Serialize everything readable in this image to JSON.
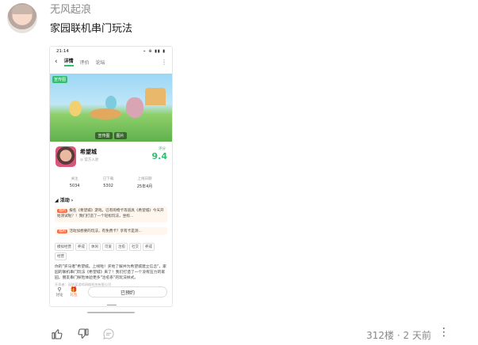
{
  "post": {
    "username": "无风起浪",
    "text": "家园联机串门玩法"
  },
  "screenshot": {
    "status_time": "21:14",
    "status_icons": "⌁ ⊕ ▮▮ ▮",
    "nav_tabs": [
      "详情",
      "评价",
      "论坛"
    ],
    "banner_tag": "宣传图",
    "banner_pills": [
      "宣传图",
      "图片"
    ],
    "app_name": "希望城",
    "app_sub": "◎ 官方入驻",
    "score_label": "评分",
    "score": "9.4",
    "stats": [
      {
        "k": "关注",
        "v": "5034"
      },
      {
        "k": "已下载",
        "v": "5302"
      },
      {
        "k": "上线日期",
        "v": "25年4月"
      }
    ],
    "section_title": "◢ 活动 ›",
    "event1_badge": "福利",
    "event1_text": "报名《希望城》游戏，已有购物卡等道具《希望城》今天开始测试啦？！我们打造了一个轻松玩法，坐标...",
    "event2_badge": "福利",
    "event2_text": "活动加想要的玩法，有免费卡？享有卡是测...",
    "chips": [
      "模拟经营",
      "养成",
      "休闲",
      "可爱",
      "治愈",
      "社交",
      "养成",
      "经营"
    ],
    "description": "你的\"买马者\"希望城。上线啦！买地了解并为希望城建立信念\"，家园的联机串门玩法《希望城》来了！我们打造了一个没有压力的家园，朋友串门探险体验更多\"治愈系\"的玩法样式。",
    "developer": "开发者：深圳某游戏网络科技有限公司",
    "bottom_buttons": [
      {
        "icon": "⚲",
        "label": "讨论"
      },
      {
        "icon": "🎁",
        "label": "礼包"
      }
    ],
    "buy_label": "已预约"
  },
  "footer": {
    "floor": "312楼",
    "dot": "·",
    "time": "2 天前"
  }
}
